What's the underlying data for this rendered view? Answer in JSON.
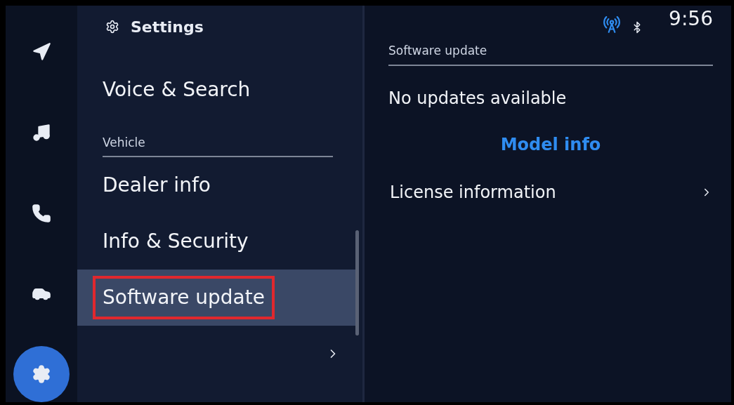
{
  "rail": [
    {
      "kind": "navigation",
      "selected": false
    },
    {
      "kind": "music",
      "selected": false
    },
    {
      "kind": "phone",
      "selected": false
    },
    {
      "kind": "car",
      "selected": false
    },
    {
      "kind": "settings",
      "selected": true
    }
  ],
  "settings": {
    "title": "Settings",
    "items": [
      {
        "kind": "item",
        "label": "Voice & Search",
        "selected": false,
        "outlined": false
      },
      {
        "kind": "header",
        "label": "Vehicle"
      },
      {
        "kind": "item",
        "label": "Dealer info",
        "selected": false,
        "outlined": false
      },
      {
        "kind": "item",
        "label": "Info & Security",
        "selected": false,
        "outlined": false
      },
      {
        "kind": "item",
        "label": "Software update",
        "selected": true,
        "outlined": true
      },
      {
        "kind": "more"
      }
    ]
  },
  "status": {
    "time": "9:56"
  },
  "detail": {
    "section": "Software update",
    "status": "No updates available",
    "button": "Model info",
    "rows": [
      {
        "label": "License information"
      }
    ]
  }
}
